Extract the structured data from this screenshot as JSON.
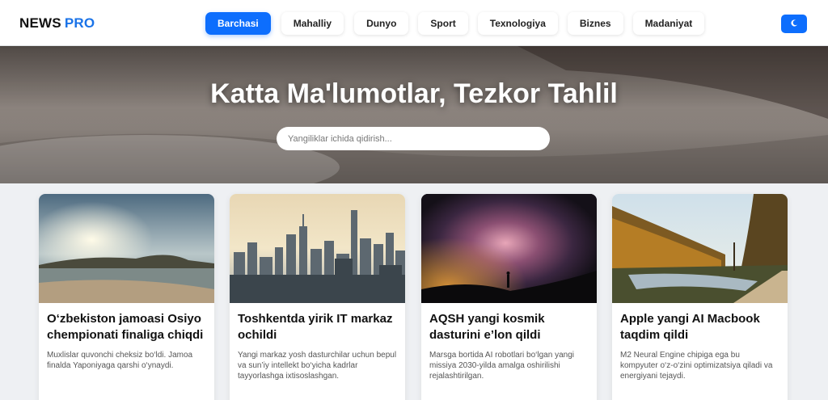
{
  "header": {
    "logo_main": "NEWS",
    "logo_accent": "PRO",
    "nav": [
      "Barchasi",
      "Mahalliy",
      "Dunyo",
      "Sport",
      "Texnologiya",
      "Biznes",
      "Madaniyat"
    ],
    "active_nav": "Barchasi",
    "theme_icon": "moon-icon"
  },
  "hero": {
    "title": "Katta Ma'lumotlar, Tezkor Tahlil",
    "search_placeholder": "Yangiliklar ichida qidirish..."
  },
  "cards": [
    {
      "title": "O‘zbekiston jamoasi Osiyo chempionati finaliga chiqdi",
      "text": "Muxlislar quvonchi cheksiz bo‘ldi. Jamoa finalda Yaponiyaga qarshi o‘ynaydi.",
      "image": "beach-sunset-photo"
    },
    {
      "title": "Toshkentda yirik IT markaz ochildi",
      "text": "Yangi markaz yosh dasturchilar uchun bepul va sun’iy intellekt bo‘yicha kadrlar tayyorlashga ixtisoslashgan.",
      "image": "city-skyline-photo"
    },
    {
      "title": "AQSH yangi kosmik dasturini e’lon qildi",
      "text": "Marsga bortida AI robotlari bo‘lgan yangi missiya 2030-yilda amalga oshirilishi rejalashtirilgan.",
      "image": "milky-way-photo"
    },
    {
      "title": "Apple yangi AI Macbook taqdim qildi",
      "text": "M2 Neural Engine chipiga ega bu kompyuter o‘z-o‘zini optimizatsiya qiladi va energiyani tejaydi.",
      "image": "autumn-lake-photo"
    }
  ],
  "colors": {
    "accent": "#0d6efd",
    "logo_accent": "#1a73e8"
  }
}
